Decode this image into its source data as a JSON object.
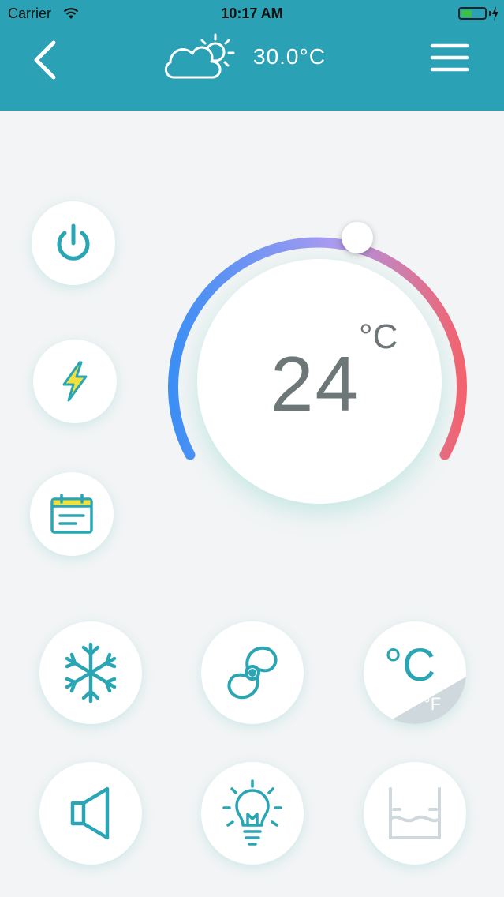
{
  "status_bar": {
    "carrier": "Carrier",
    "time": "10:17 AM",
    "battery_level": 0.45
  },
  "header": {
    "weather_temp": "30.0°C",
    "weather_icon": "partly-cloudy-icon",
    "back_icon": "chevron-left-icon",
    "menu_icon": "hamburger-menu-icon"
  },
  "thermostat": {
    "setpoint": "24",
    "unit": "°C",
    "colors": {
      "cold": "#3d8ff5",
      "mid": "#a99bf0",
      "hot": "#f3636f"
    }
  },
  "side_controls": [
    {
      "name": "power-button",
      "icon": "power-icon"
    },
    {
      "name": "turbo-button",
      "icon": "lightning-icon"
    },
    {
      "name": "schedule-button",
      "icon": "calendar-icon"
    }
  ],
  "mode_controls": [
    {
      "name": "cool-mode-button",
      "icon": "snowflake-icon"
    },
    {
      "name": "fan-button",
      "icon": "fan-icon"
    },
    {
      "name": "unit-toggle-button",
      "icon": "temperature-unit-icon",
      "primary": "°C",
      "secondary": "°F"
    },
    {
      "name": "sound-button",
      "icon": "speaker-icon"
    },
    {
      "name": "light-button",
      "icon": "lightbulb-icon"
    },
    {
      "name": "water-level-button",
      "icon": "water-tank-icon"
    }
  ],
  "theme": {
    "accent": "#2aa1b5",
    "icon_color": "#2aa5b3",
    "text_gray": "#6e7778"
  }
}
